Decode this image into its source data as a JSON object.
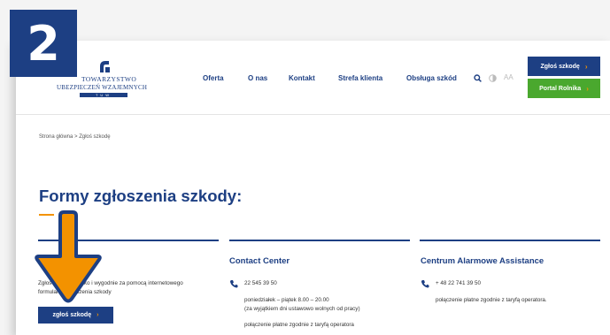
{
  "step_badge": "2",
  "logo": {
    "line1": "TOWARZYSTWO",
    "line2": "UBEZPIECZEŃ WZAJEMNYCH",
    "line3": "TUW"
  },
  "nav": {
    "items": [
      "Oferta",
      "O nas",
      "Kontakt",
      "Strefa klienta",
      "Obsługa szkód"
    ]
  },
  "utilities": {
    "search_icon": "search-icon",
    "contrast_icon": "contrast-icon",
    "font_size_label": "AA"
  },
  "header_buttons": {
    "report_claim": "Zgłoś szkodę",
    "farmer_portal": "Portal Rolnika"
  },
  "breadcrumb": {
    "home": "Strona główna",
    "separator": ">",
    "current": "Zgłoś szkodę"
  },
  "main": {
    "title": "Formy zgłoszenia szkody:",
    "col1": {
      "text_line1": "Zgłoś szkodę szybko i wygodnie za pomocą internetowego",
      "text_line2": "formularza zgłoszenia szkody",
      "button_label": "zgłoś szkodę"
    },
    "col2": {
      "heading": "Contact Center",
      "phone": "22 545 39 50",
      "hours": "poniedziałek – piątek 8.00 – 20.00",
      "hours_note": "(za wyjątkiem dni ustawowo wolnych od pracy)",
      "charge_note": "połączenie płatne zgodnie z taryfą operatora"
    },
    "col3": {
      "heading": "Centrum Alarmowe Assistance",
      "phone": "+ 48 22 741 39 50",
      "charge_note": "połączenie płatne zgodnie z taryfą operatora."
    }
  },
  "colors": {
    "brand_blue": "#1d3f83",
    "accent_orange": "#f39200",
    "green_button": "#4aa82e"
  },
  "annotation": {
    "arrow_icon": "down-arrow-icon"
  }
}
